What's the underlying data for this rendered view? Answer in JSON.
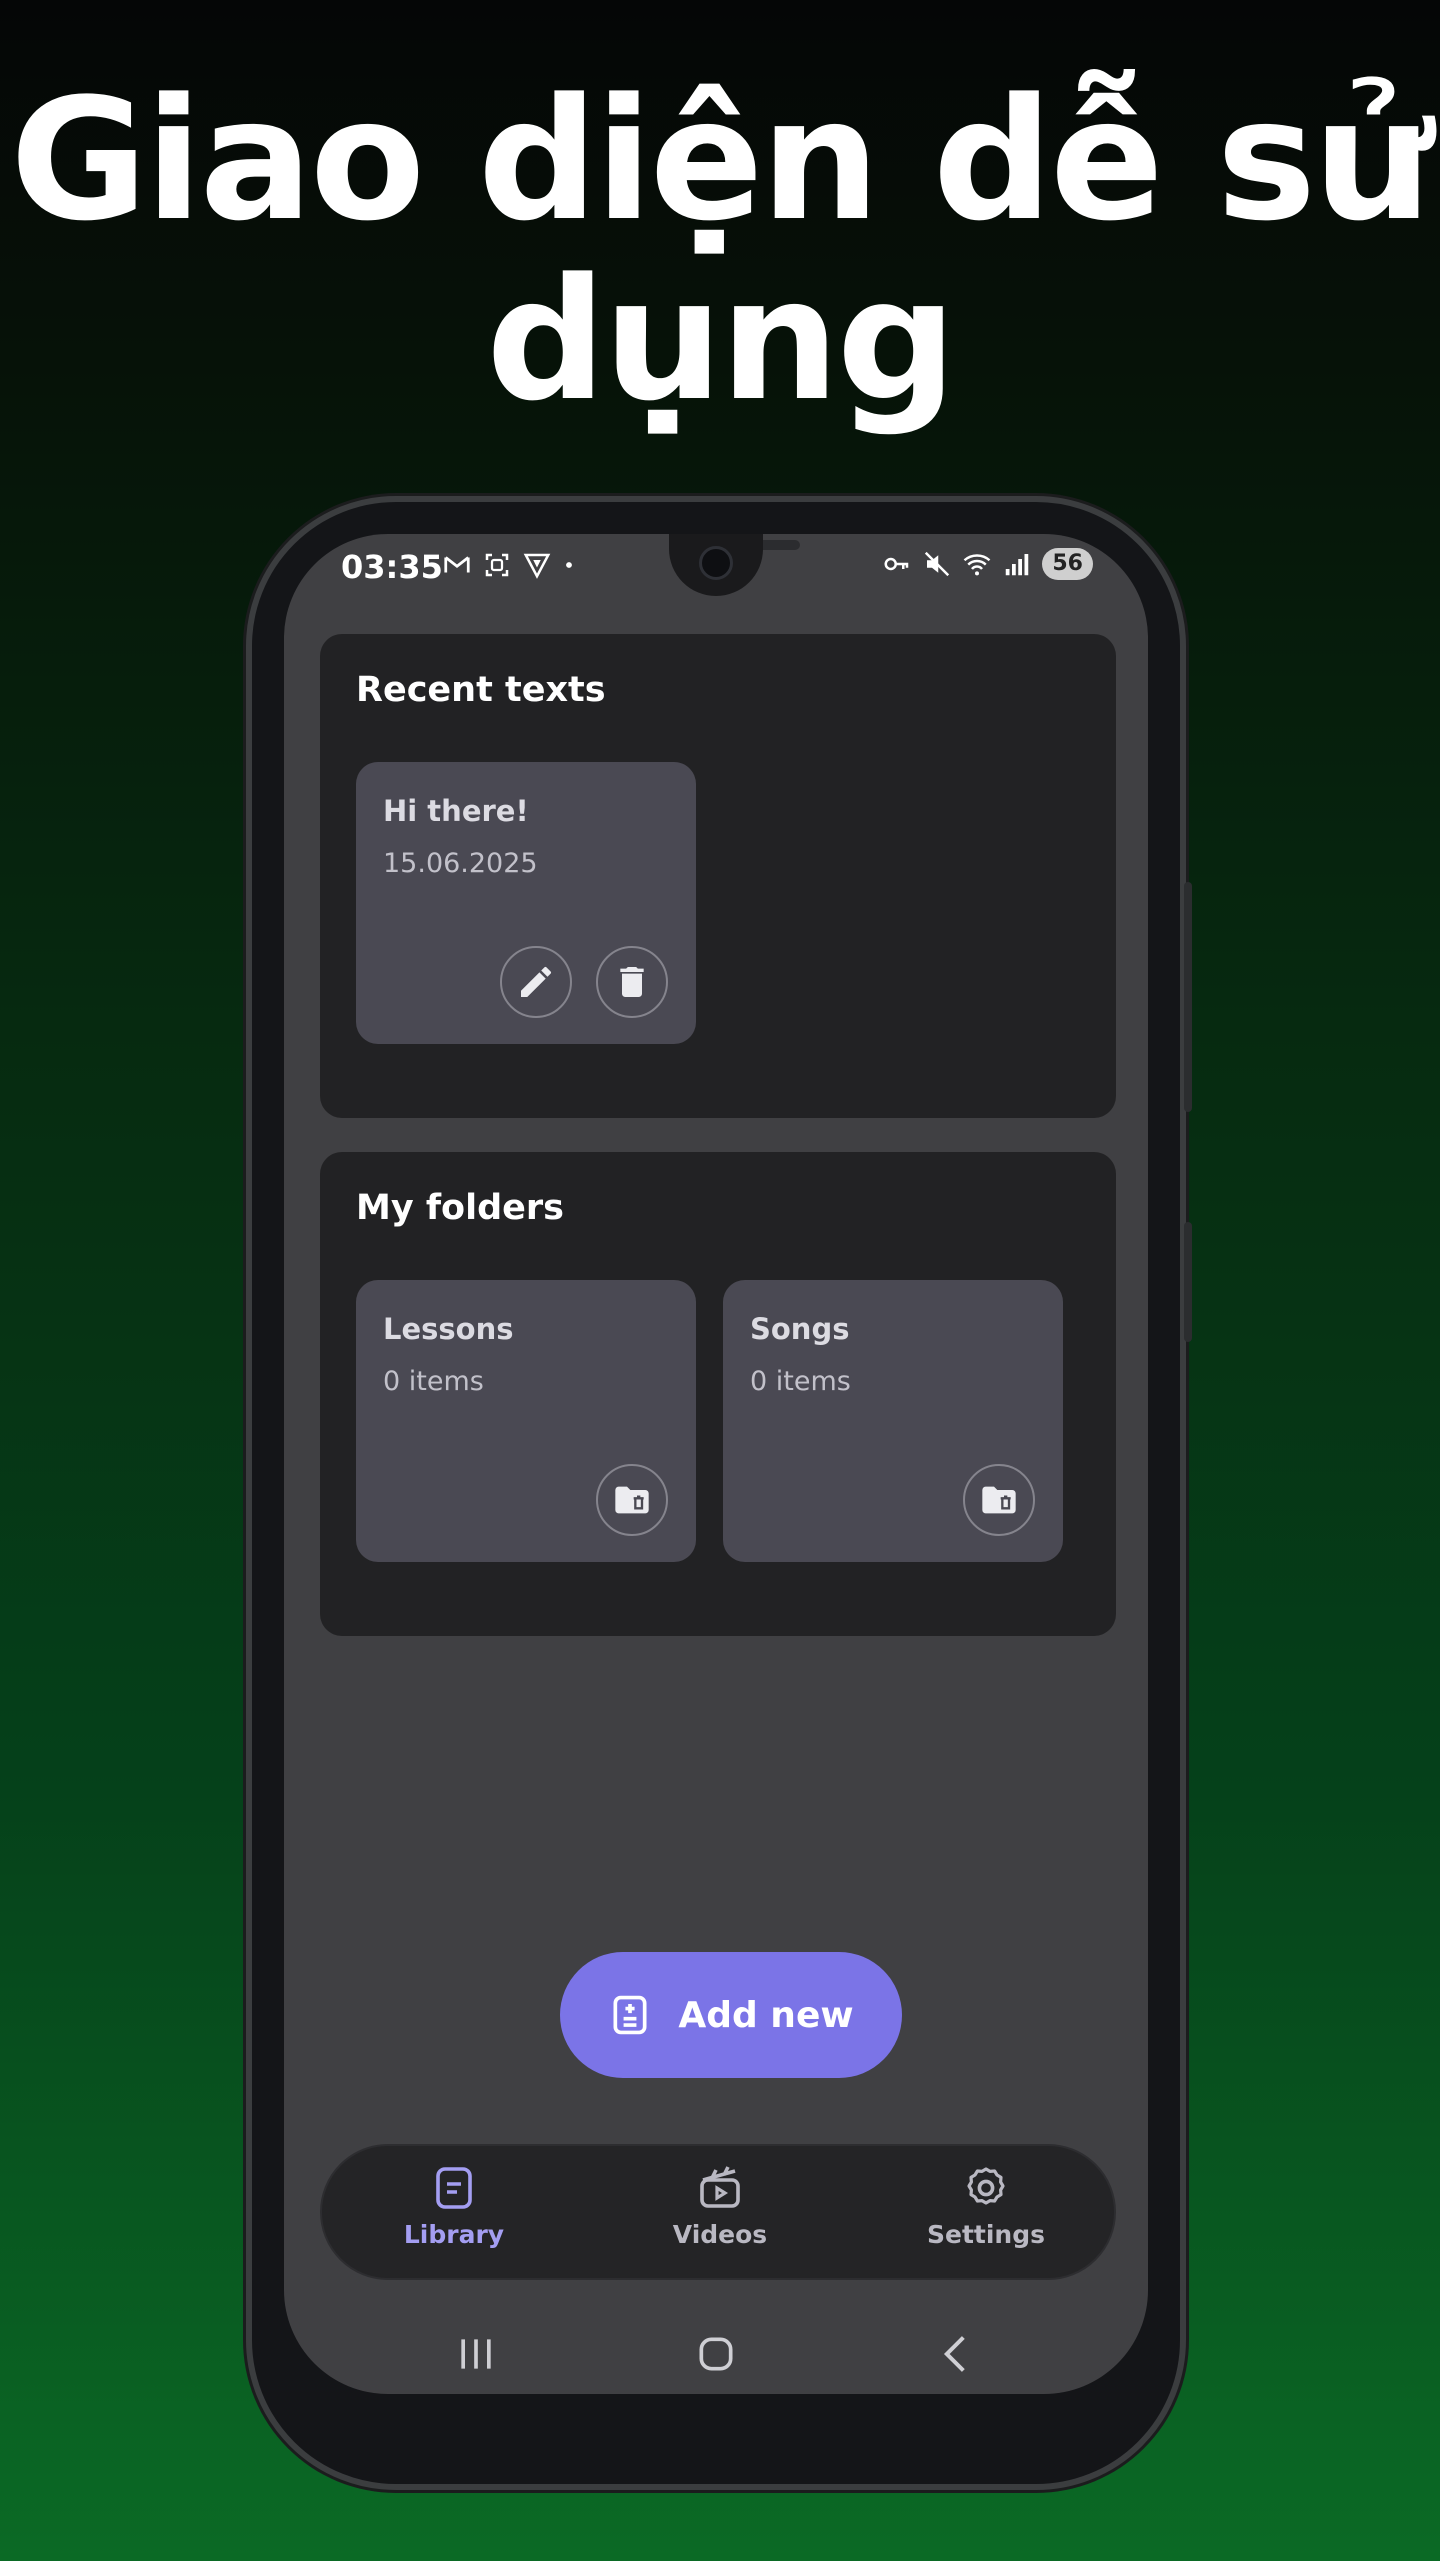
{
  "promo": {
    "headline_line1": "Giao diện dễ sử",
    "headline_line2": "dụng"
  },
  "status_bar": {
    "time": "03:35",
    "left_icons": [
      "gmail-icon",
      "screenshot-icon",
      "vpn-shield-icon",
      "dot-icon"
    ],
    "right_icons": [
      "key-icon",
      "mute-icon",
      "wifi-icon",
      "signal-icon"
    ],
    "battery": "56"
  },
  "recent_texts": {
    "title": "Recent texts",
    "items": [
      {
        "title": "Hi there!",
        "date": "15.06.2025"
      }
    ]
  },
  "folders": {
    "title": "My folders",
    "items": [
      {
        "name": "Lessons",
        "count": "0 items"
      },
      {
        "name": "Songs",
        "count": "0 items"
      }
    ]
  },
  "fab": {
    "label": "Add new"
  },
  "bottom_nav": {
    "items": [
      {
        "label": "Library",
        "icon": "document-icon",
        "active": true
      },
      {
        "label": "Videos",
        "icon": "video-clapper-icon",
        "active": false
      },
      {
        "label": "Settings",
        "icon": "gear-icon",
        "active": false
      }
    ]
  },
  "system_nav": [
    "recents-icon",
    "home-icon",
    "back-icon"
  ],
  "colors": {
    "accent": "#7b74e7",
    "accent_text": "#a49ef2",
    "card": "#222224",
    "tile": "#4a4953",
    "screen_bg": "#404043"
  }
}
